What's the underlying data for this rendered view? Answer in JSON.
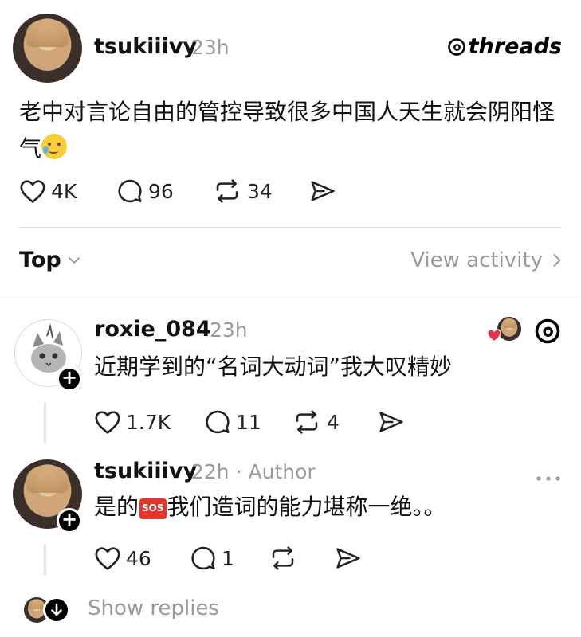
{
  "post": {
    "username": "tsukiiivy",
    "time": "23h",
    "brand": "threads",
    "text": "老中对言论自由的管控导致很多中国人天生就会阴阳怪气",
    "likes": "4K",
    "replies": "96",
    "reposts": "34"
  },
  "sort": {
    "label": "Top",
    "view_activity": "View activity"
  },
  "comments": [
    {
      "username": "roxie_084",
      "time": "23h",
      "text": "近期学到的“名词大动词”我大叹精妙",
      "likes": "1.7K",
      "replies": "11",
      "reposts": "4"
    },
    {
      "username": "tsukiiivy",
      "time": "22h",
      "author_tag": "· Author",
      "text_before": "是的",
      "sos": "SOS",
      "text_after": "我们造词的能力堪称一绝。。",
      "likes": "46",
      "replies": "1"
    }
  ],
  "show_replies": "Show replies",
  "colors": {
    "heart_red": "#e8344b",
    "badge_black": "#000000",
    "muted_gray": "#9a9a9a"
  },
  "icons": [
    "heart-icon",
    "comment-icon",
    "repost-icon",
    "share-icon",
    "chevron-down-icon",
    "chevron-right-icon",
    "threads-logo-icon",
    "more-icon",
    "plus-icon",
    "arrow-down-icon"
  ]
}
